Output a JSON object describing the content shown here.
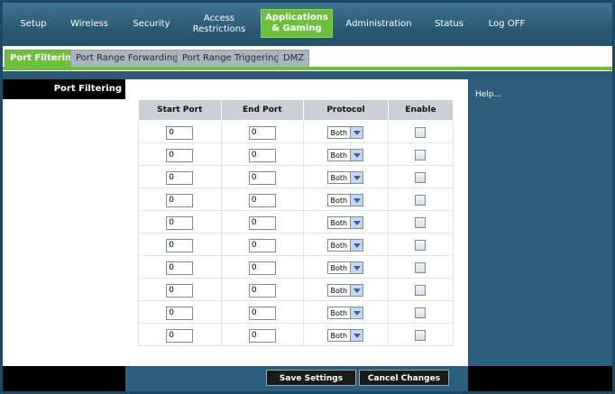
{
  "nav": {
    "items": [
      {
        "label": "Setup"
      },
      {
        "label": "Wireless"
      },
      {
        "label": "Security"
      },
      {
        "label": "Access\nRestrictions"
      },
      {
        "label": "Applications\n& Gaming",
        "active": true
      },
      {
        "label": "Administration"
      },
      {
        "label": "Status"
      },
      {
        "label": "Log OFF"
      }
    ]
  },
  "subtabs": [
    {
      "label": "Port Filtering",
      "active": true
    },
    {
      "label": "Port Range Forwarding"
    },
    {
      "label": "Port Range Triggering"
    },
    {
      "label": "DMZ"
    }
  ],
  "section_title": "Port Filtering",
  "help": {
    "label": "Help..."
  },
  "table": {
    "headers": [
      "Start Port",
      "End Port",
      "Protocol",
      "Enable"
    ],
    "rows": [
      {
        "start": "0",
        "end": "0",
        "protocol": "Both",
        "enabled": false
      },
      {
        "start": "0",
        "end": "0",
        "protocol": "Both",
        "enabled": false
      },
      {
        "start": "0",
        "end": "0",
        "protocol": "Both",
        "enabled": false
      },
      {
        "start": "0",
        "end": "0",
        "protocol": "Both",
        "enabled": false
      },
      {
        "start": "0",
        "end": "0",
        "protocol": "Both",
        "enabled": false
      },
      {
        "start": "0",
        "end": "0",
        "protocol": "Both",
        "enabled": false
      },
      {
        "start": "0",
        "end": "0",
        "protocol": "Both",
        "enabled": false
      },
      {
        "start": "0",
        "end": "0",
        "protocol": "Both",
        "enabled": false
      },
      {
        "start": "0",
        "end": "0",
        "protocol": "Both",
        "enabled": false
      },
      {
        "start": "0",
        "end": "0",
        "protocol": "Both",
        "enabled": false
      }
    ]
  },
  "buttons": {
    "save": "Save Settings",
    "cancel": "Cancel Changes"
  },
  "colors": {
    "accent": "#6fbf3e",
    "nav_bg": "#2b5a74",
    "help_bg": "#2d5e7b"
  }
}
